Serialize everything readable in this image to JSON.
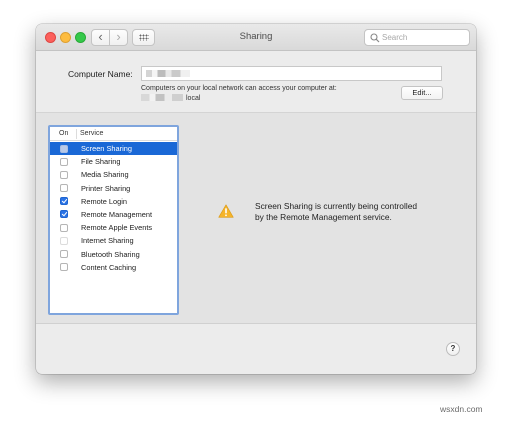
{
  "window": {
    "title": "Sharing",
    "nav": {
      "back_glyph": "‹",
      "forward_glyph": "›"
    },
    "search": {
      "placeholder": "Search"
    }
  },
  "computer": {
    "label": "Computer Name:",
    "info_line1": "Computers on your local network can access your computer at:",
    "info_suffix": "local",
    "edit_label": "Edit..."
  },
  "services": {
    "header_on": "On",
    "header_service": "Service",
    "items": [
      {
        "label": "Screen Sharing",
        "checked": false,
        "selected": true
      },
      {
        "label": "File Sharing",
        "checked": false
      },
      {
        "label": "Media Sharing",
        "checked": false
      },
      {
        "label": "Printer Sharing",
        "checked": false
      },
      {
        "label": "Remote Login",
        "checked": true
      },
      {
        "label": "Remote Management",
        "checked": true
      },
      {
        "label": "Remote Apple Events",
        "checked": false
      },
      {
        "label": "Internet Sharing",
        "checked": false,
        "disabled": true
      },
      {
        "label": "Bluetooth Sharing",
        "checked": false
      },
      {
        "label": "Content Caching",
        "checked": false
      }
    ]
  },
  "status": {
    "icon": "warning-icon",
    "line1": "Screen Sharing is currently being controlled",
    "line2": "by the Remote Management service."
  },
  "help": {
    "label": "?"
  },
  "watermark": "wsxdn.com",
  "colors": {
    "selection": "#1a68d6",
    "checkbox_checked": "#2a73e6",
    "warning": "#f5b42a"
  }
}
